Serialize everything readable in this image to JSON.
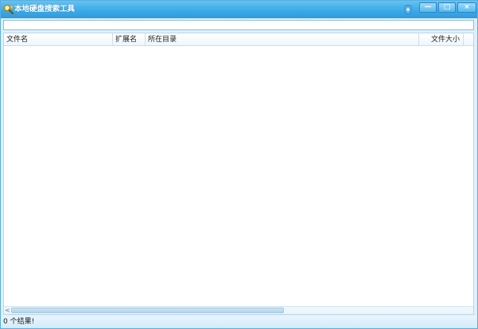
{
  "window": {
    "title": "本地硬盘搜索工具",
    "accent_color": "#3aa8e6",
    "icons": {
      "app": "magnifier-people-icon",
      "skin": "skin-icon",
      "minimize": "minimize-icon",
      "maximize": "maximize-icon",
      "close": "close-icon"
    },
    "buttons": {
      "minimize_glyph": "—",
      "maximize_glyph": "□",
      "close_glyph": "×"
    }
  },
  "search": {
    "value": "",
    "placeholder": ""
  },
  "table": {
    "columns": [
      "文件名",
      "扩展名",
      "所在目录",
      "文件大小"
    ],
    "rows": []
  },
  "scrollbar": {
    "left_arrow": "<"
  },
  "status": {
    "text": "0 个结果!"
  }
}
